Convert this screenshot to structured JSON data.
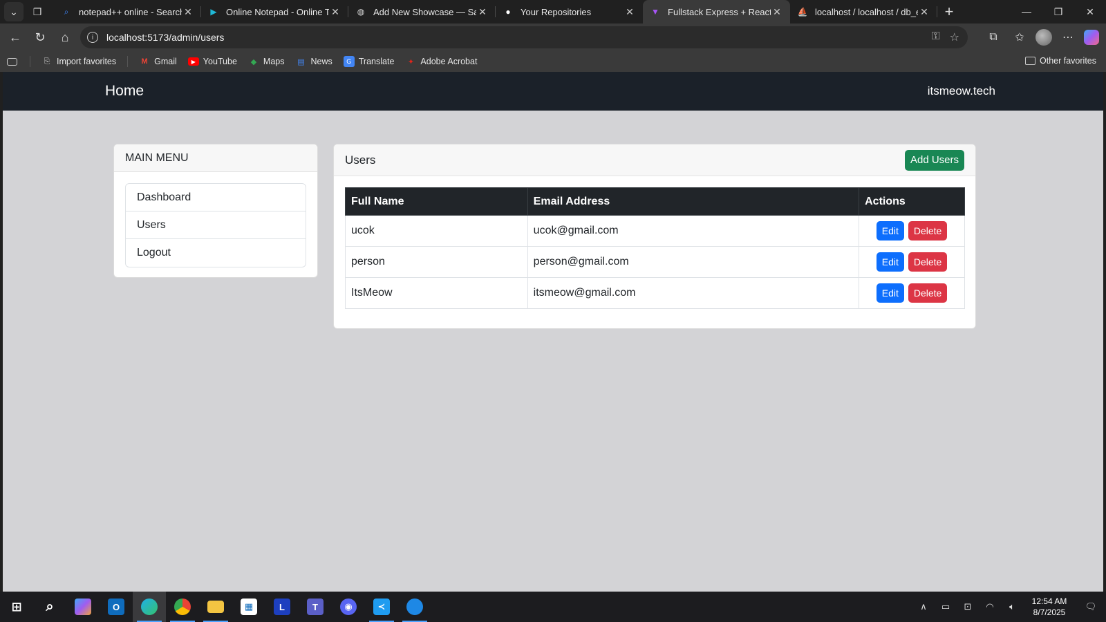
{
  "browser": {
    "tabs": [
      {
        "title": "notepad++ online - Search",
        "icon": "search-icon",
        "color": "#3b82f6"
      },
      {
        "title": "Online Notepad - Online Text",
        "icon": "notepad-play-icon",
        "color": "#1fb8d6"
      },
      {
        "title": "Add New Showcase — Santri",
        "icon": "santri-icon",
        "color": "#dddddd"
      },
      {
        "title": "Your Repositories",
        "icon": "github-icon",
        "color": "#ffffff"
      },
      {
        "title": "Fullstack Express + React",
        "icon": "vite-icon",
        "color": "#a855f7"
      },
      {
        "title": "localhost / localhost / db_exp",
        "icon": "phpmyadmin-icon",
        "color": "#f59e0b"
      }
    ],
    "url": "localhost:5173/admin/users",
    "favorites": [
      {
        "label": "Import favorites",
        "icon": "import-icon"
      },
      {
        "label": "Gmail",
        "icon": "gmail-icon"
      },
      {
        "label": "YouTube",
        "icon": "youtube-icon"
      },
      {
        "label": "Maps",
        "icon": "maps-icon"
      },
      {
        "label": "News",
        "icon": "news-icon"
      },
      {
        "label": "Translate",
        "icon": "translate-icon"
      },
      {
        "label": "Adobe Acrobat",
        "icon": "acrobat-icon"
      }
    ],
    "other_favorites": "Other favorites"
  },
  "app": {
    "brand": "Home",
    "nav_right": "itsmeow.tech",
    "sidebar": {
      "title": "MAIN MENU",
      "items": [
        "Dashboard",
        "Users",
        "Logout"
      ]
    },
    "main": {
      "title": "Users",
      "add_button": "Add Users",
      "columns": [
        "Full Name",
        "Email Address",
        "Actions"
      ],
      "rows": [
        {
          "name": "ucok",
          "email": "ucok@gmail.com"
        },
        {
          "name": "person",
          "email": "person@gmail.com"
        },
        {
          "name": "ItsMeow",
          "email": "itsmeow@gmail.com"
        }
      ],
      "edit_label": "Edit",
      "delete_label": "Delete"
    }
  },
  "taskbar": {
    "time": "12:54 AM",
    "date": "8/7/2025"
  }
}
